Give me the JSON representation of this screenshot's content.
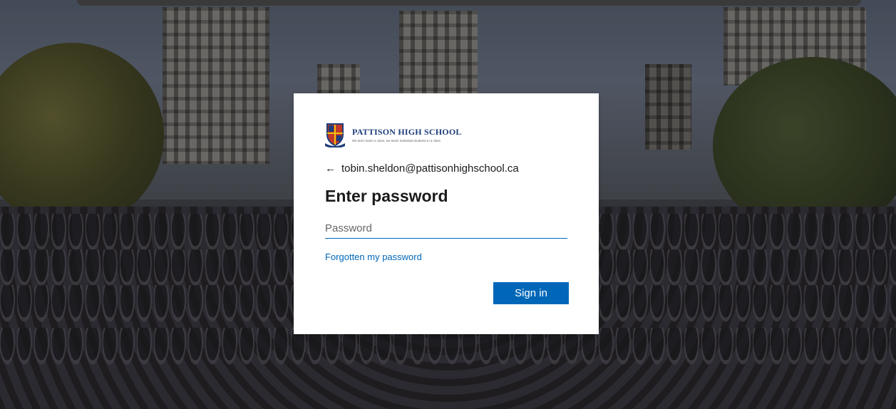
{
  "school": {
    "name": "PATTISON HIGH SCHOOL",
    "tagline": "We don't teach a class, we teach individual students in a class"
  },
  "login": {
    "email": "tobin.sheldon@pattisonhighschool.ca",
    "back_icon": "arrow-left-icon",
    "title": "Enter password",
    "password_placeholder": "Password",
    "password_value": "",
    "forgot_link": "Forgotten my password",
    "signin_label": "Sign in"
  },
  "colors": {
    "accent": "#0067b8",
    "card_bg": "#ffffff",
    "brand": "#1e3d7a"
  }
}
